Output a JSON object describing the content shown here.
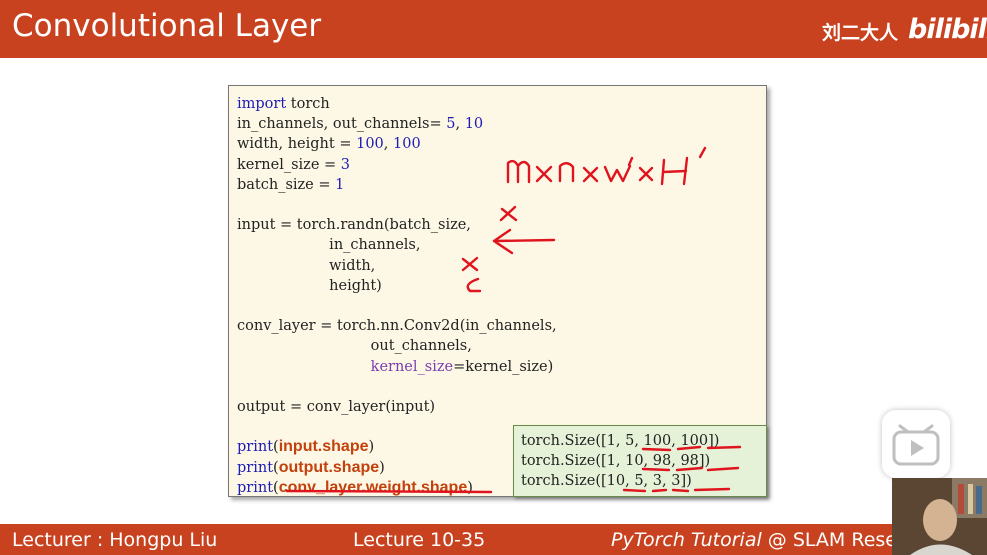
{
  "header": {
    "title": "Convolutional Layer",
    "watermark": "刘二大人",
    "logo": "bilibili"
  },
  "code": {
    "lines": [
      "import torch",
      "in_channels, out_channels= 5, 10",
      "width, height = 100, 100",
      "kernel_size = 3",
      "batch_size = 1",
      "",
      "input = torch.randn(batch_size,",
      "                    in_channels,",
      "                    width,",
      "                    height)",
      "",
      "conv_layer = torch.nn.Conv2d(in_channels,",
      "                             out_channels,",
      "                             kernel_size=kernel_size)",
      "",
      "output = conv_layer(input)",
      "",
      "print(input.shape)",
      "print(output.shape)",
      "print(conv_layer.weight.shape)"
    ]
  },
  "output": {
    "lines": [
      "torch.Size([1, 5, 100, 100])",
      "torch.Size([1, 10, 98, 98])",
      "torch.Size([10, 5, 3, 3])"
    ]
  },
  "annotation": {
    "handwriting": "m×n×w'×H'"
  },
  "footer": {
    "lecturer": "Lecturer : Hongpu Liu",
    "lecture": "Lecture 10-35",
    "tutorial_italic": "PyTorch Tutorial",
    "tutorial_rest": " @ SLAM Resea"
  },
  "colors": {
    "accent": "#c9421f",
    "code_bg": "#fdf8e6",
    "output_bg": "#e6f2d8",
    "ink": "#e0141e"
  }
}
